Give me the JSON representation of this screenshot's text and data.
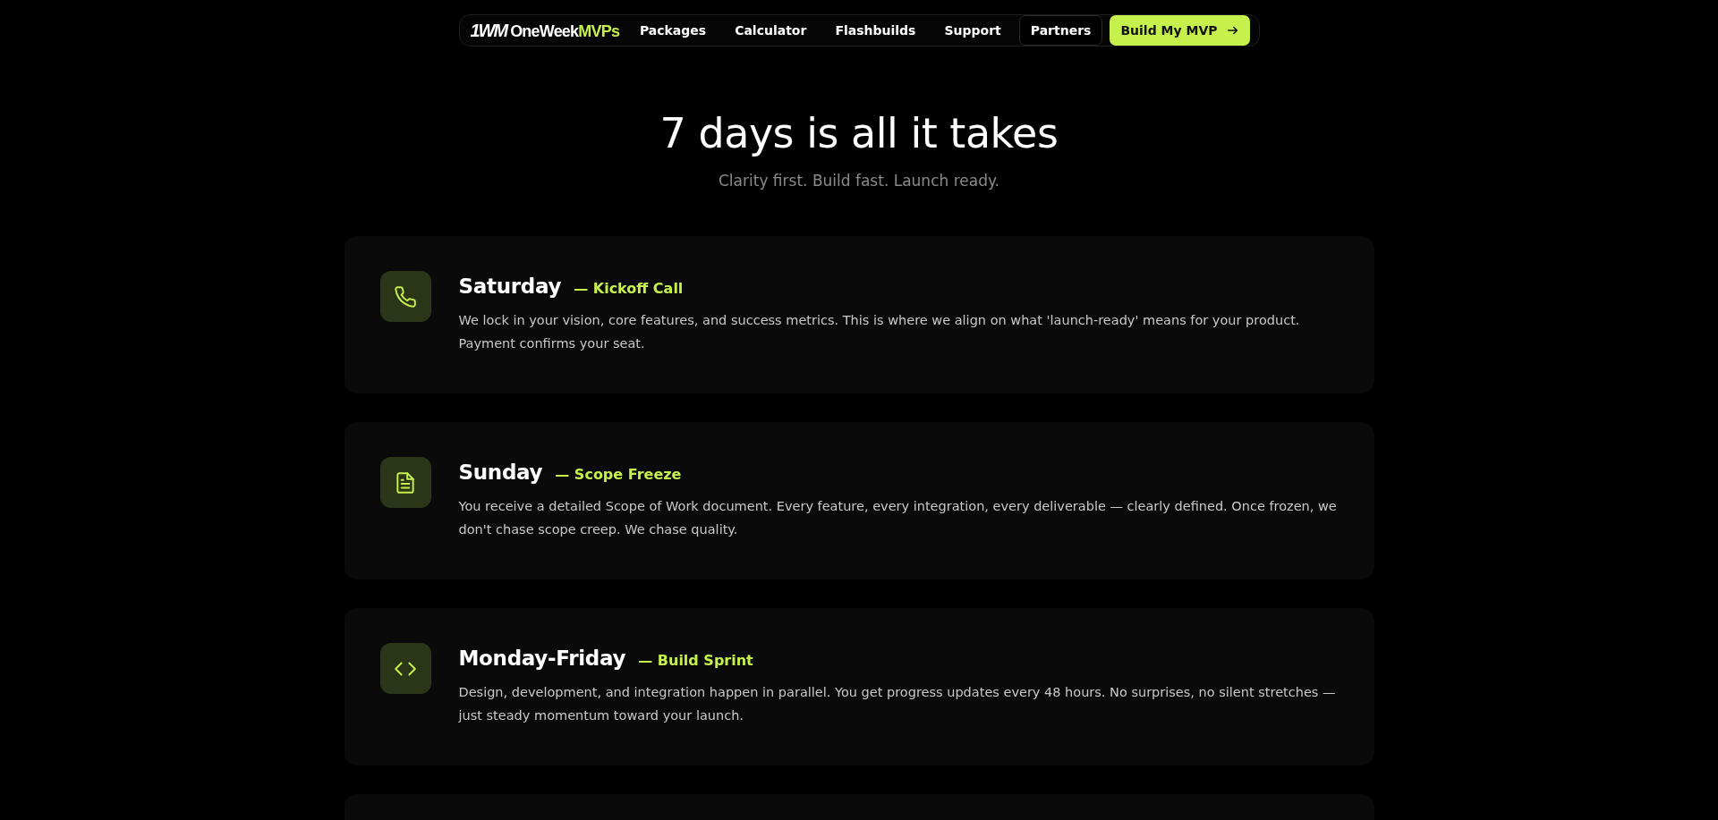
{
  "nav": {
    "logo": {
      "mark": "1WM",
      "name": "OneWeek",
      "accent": "MVPs"
    },
    "links": [
      {
        "label": "Packages",
        "kind": "link"
      },
      {
        "label": "Calculator",
        "kind": "link"
      },
      {
        "label": "Flashbuilds",
        "kind": "link"
      },
      {
        "label": "Support",
        "kind": "link"
      },
      {
        "label": "Partners",
        "kind": "outline"
      },
      {
        "label": "Build My MVP",
        "kind": "cta"
      }
    ]
  },
  "hero": {
    "title": "7 days is all it takes",
    "subtitle": "Clarity first. Build fast. Launch ready."
  },
  "steps": [
    {
      "kind": "phone",
      "day": "Saturday",
      "phase": "— Kickoff Call",
      "text": "We lock in your vision, core features, and success metrics. This is where we align on what 'launch-ready' means for your product. Payment confirms your seat."
    },
    {
      "kind": "document",
      "day": "Sunday",
      "phase": "— Scope Freeze",
      "text": "You receive a detailed Scope of Work document. Every feature, every integration, every deliverable — clearly defined. Once frozen, we don't chase scope creep. We chase quality."
    },
    {
      "kind": "code",
      "day": "Monday-Friday",
      "phase": "— Build Sprint",
      "text": "Design, development, and integration happen in parallel. You get progress updates every 48 hours. No surprises, no silent stretches — just steady momentum toward your launch."
    }
  ]
}
